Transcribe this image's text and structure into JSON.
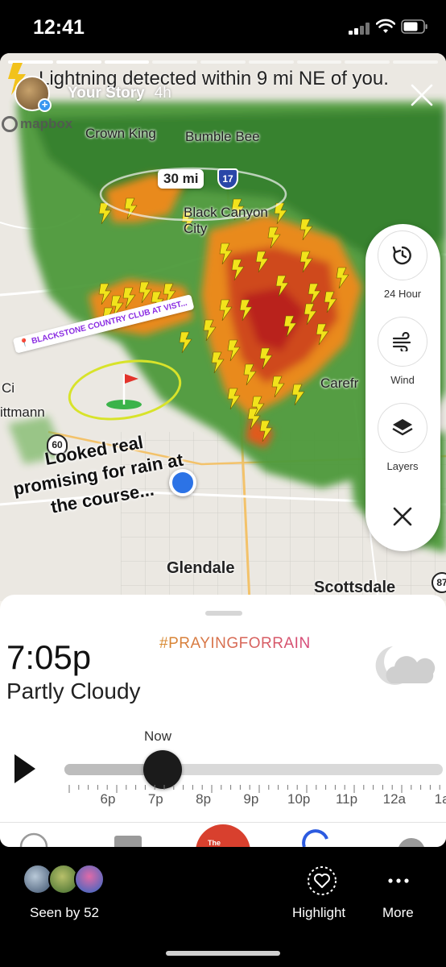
{
  "status_bar": {
    "time": "12:41"
  },
  "story": {
    "alert_text": "Lightning detected within 9 mi NE of you.",
    "user": "Your Story",
    "age": "4h",
    "progress_segments": 9,
    "current_segment": 3
  },
  "map": {
    "attribution": "mapbox",
    "scale": "30 mi",
    "labels": {
      "crown_king": "Crown King",
      "bumble_bee": "Bumble Bee",
      "black_canyon_city": "Black Canyon City",
      "carefree": "Carefr",
      "city_partial": "Ci",
      "wittmann": "ittmann",
      "glendale": "Glendale",
      "scottsdale": "Scottsdale"
    },
    "highway_shields": {
      "interstate": "17",
      "us_route": "60",
      "state_route": "87"
    },
    "location_sticker": "BLACKSTONE COUNTRY CLUB AT VIST...",
    "caption_lines": [
      "Looked real",
      "promising for rain at",
      "the course..."
    ]
  },
  "controls": {
    "history_label": "24 Hour",
    "wind_label": "Wind",
    "layers_label": "Layers"
  },
  "sheet": {
    "time": "7:05p",
    "condition": "Partly Cloudy",
    "hashtag": "#PRAYINGFORRAIN",
    "now_label": "Now",
    "hours": [
      "6p",
      "7p",
      "8p",
      "9p",
      "10p",
      "11p",
      "12a",
      "1a"
    ],
    "timeline_position_fraction": 0.26,
    "tabs_partial": {
      "center_label": "The"
    }
  },
  "bottom_bar": {
    "seen_by": "Seen by 52",
    "highlight": "Highlight",
    "more": "More"
  },
  "colors": {
    "accent_blue": "#2c73e6",
    "radar_green": "#3f8f2f",
    "radar_red": "#c83a1c",
    "lightning_yellow": "#f2e31b"
  }
}
